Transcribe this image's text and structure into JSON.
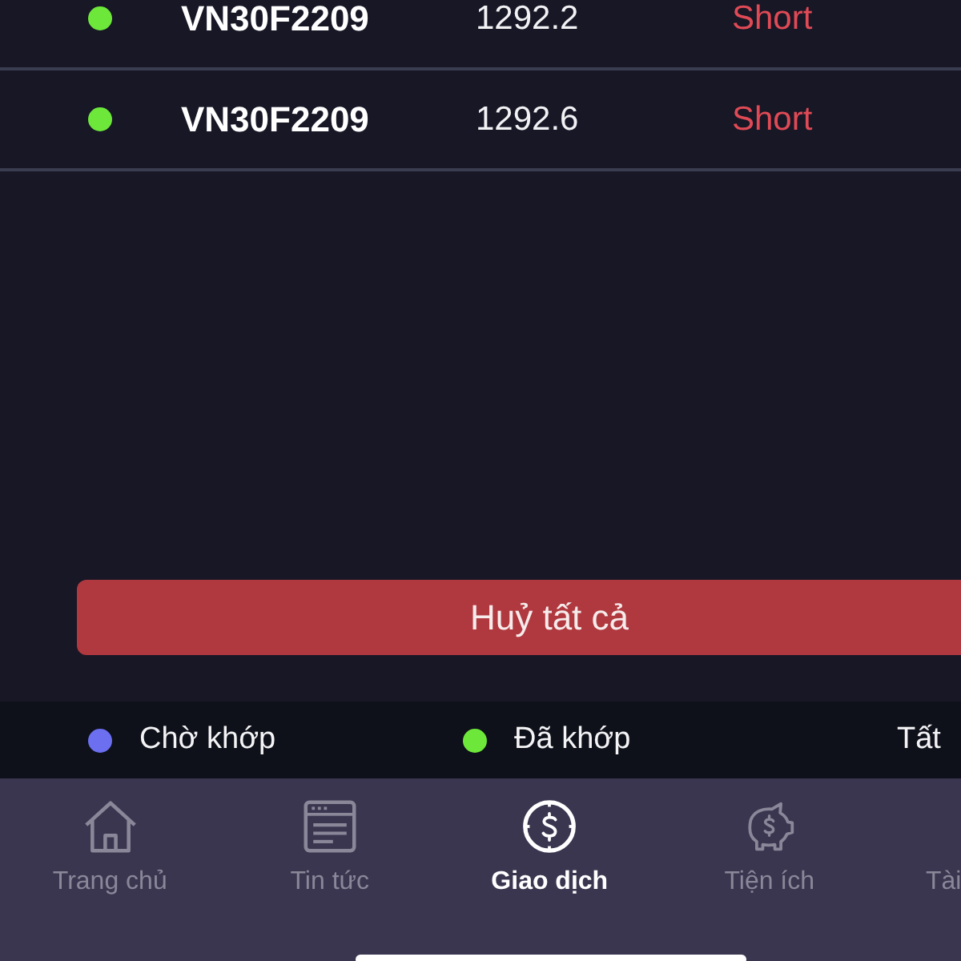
{
  "orders": [
    {
      "symbol": "VN30F2209",
      "price": "1292.2",
      "side": "Short",
      "color": "#6de83a"
    },
    {
      "symbol": "VN30F2209",
      "price": "1292.6",
      "side": "Short",
      "color": "#6de83a"
    }
  ],
  "cancel_all_button": {
    "label": "Huỷ tất cả"
  },
  "legend": [
    {
      "label": "Chờ khớp",
      "color": "#6b6ff0"
    },
    {
      "label": "Đã khớp",
      "color": "#6de83a"
    },
    {
      "label": "Tất"
    }
  ],
  "bottom_nav": [
    {
      "label": "Trang chủ",
      "kind": "home",
      "selected": false
    },
    {
      "label": "Tin tức",
      "kind": "news",
      "selected": false
    },
    {
      "label": "Giao dịch",
      "kind": "trade",
      "selected": true
    },
    {
      "label": "Tiện ích",
      "kind": "utility",
      "selected": false
    },
    {
      "label": "Tài",
      "selected": false
    }
  ]
}
